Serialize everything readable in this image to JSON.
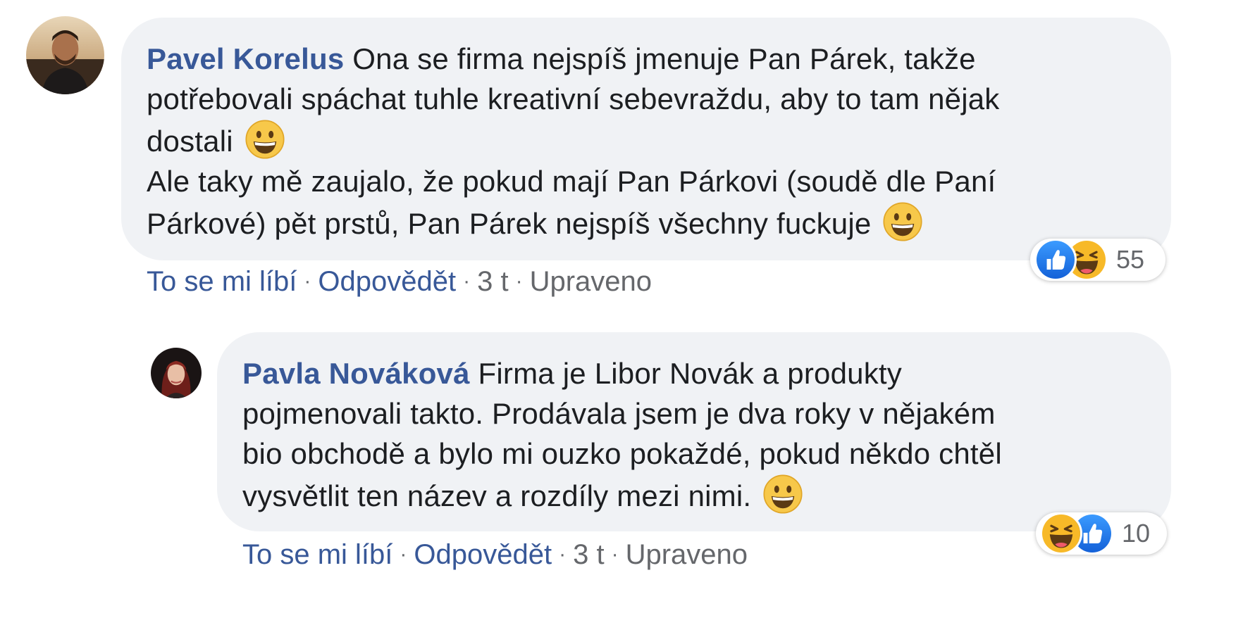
{
  "comments": [
    {
      "author": "Pavel Korelus",
      "lines": [
        "Ona se firma nejspíš jmenuje Pan Párek, takže",
        "potřebovali spáchat tuhle kreativní sebevraždu, aby to tam nějak",
        "dostali",
        "Ale taky mě zaujalo, že pokud mají Pan Párkovi (soudě dle Paní",
        "Párkové) pět prstů, Pan Párek nejspíš všechny fuckuje"
      ],
      "emoji": "grinning-face-emoji",
      "actions": {
        "like": "To se mi líbí",
        "reply": "Odpovědět",
        "separator": "·",
        "time": "3 t",
        "edited": "Upraveno"
      },
      "reactions": {
        "icons": [
          "like-icon",
          "haha-icon"
        ],
        "count": "55"
      }
    },
    {
      "author": "Pavla Nováková",
      "lines": [
        "Firma je Libor Novák a produkty",
        "pojmenovali takto. Prodávala jsem je dva roky v nějakém",
        "bio obchodě a bylo mi ouzko pokaždé, pokud někdo chtěl",
        "vysvětlit ten název a rozdíly mezi nimi."
      ],
      "emoji": "grinning-face-emoji",
      "actions": {
        "like": "To se mi líbí",
        "reply": "Odpovědět",
        "separator": "·",
        "time": "3 t",
        "edited": "Upraveno"
      },
      "reactions": {
        "icons": [
          "haha-icon",
          "like-icon"
        ],
        "count": "10"
      }
    }
  ],
  "colors": {
    "author": "#385898",
    "bubble": "#f0f2f5",
    "meta": "#65676b",
    "like": "#1877f2",
    "haha": "#f7b928"
  }
}
